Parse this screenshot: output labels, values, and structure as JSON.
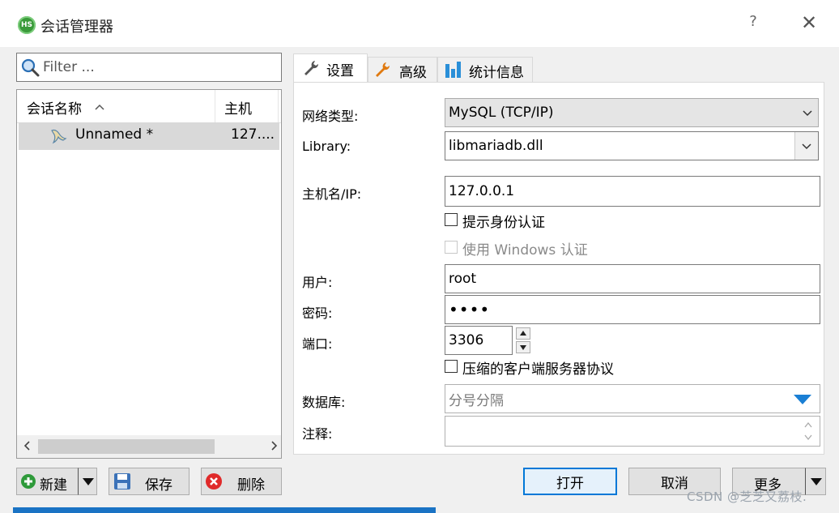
{
  "window": {
    "title": "会话管理器",
    "app_icon_text": "HS",
    "help_glyph": "?",
    "close_glyph": "✕"
  },
  "filter": {
    "placeholder": "Filter ..."
  },
  "tree": {
    "col_name": "会话名称",
    "col_host": "主机",
    "sessions": [
      {
        "name": "Unnamed *",
        "host": "127...."
      }
    ]
  },
  "left_buttons": {
    "new": "新建",
    "save": "保存",
    "delete": "删除"
  },
  "tabs": [
    {
      "label": "设置",
      "icon": "wrench-icon",
      "active": true
    },
    {
      "label": "高级",
      "icon": "wrench-orange-icon",
      "active": false
    },
    {
      "label": "统计信息",
      "icon": "bar-chart-icon",
      "active": false
    }
  ],
  "settings": {
    "network_type_label": "网络类型:",
    "network_type_value": "MySQL (TCP/IP)",
    "library_label": "Library:",
    "library_value": "libmariadb.dll",
    "host_label": "主机名/IP:",
    "host_value": "127.0.0.1",
    "prompt_auth_label": "提示身份认证",
    "windows_auth_label": "使用 Windows 认证",
    "user_label": "用户:",
    "user_value": "root",
    "password_label": "密码:",
    "password_value": "••••",
    "port_label": "端口:",
    "port_value": "3306",
    "compress_label": "压缩的客户端服务器协议",
    "database_label": "数据库:",
    "database_placeholder": "分号分隔",
    "comment_label": "注释:"
  },
  "bottom_buttons": {
    "open": "打开",
    "cancel": "取消",
    "more": "更多"
  },
  "watermark": "CSDN @芝芝又荔枝.",
  "colors": {
    "accent": "#0078d7",
    "selected_row": "#d9d9d9",
    "dropdown_arrow": "#1a7fd4"
  }
}
